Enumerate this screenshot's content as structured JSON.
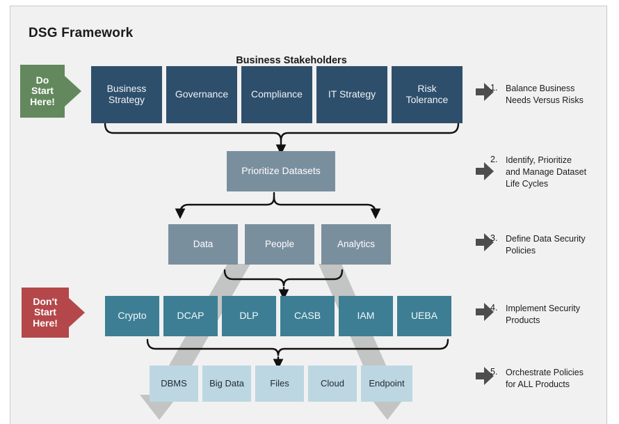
{
  "title": "DSG Framework",
  "section_label": "Business Stakeholders",
  "callouts": {
    "do": {
      "line1": "Do",
      "line2": "Start",
      "line3": "Here!",
      "color": "#63885e"
    },
    "dont": {
      "line1": "Don't",
      "line2": "Start",
      "line3": "Here!",
      "color": "#b4474a"
    }
  },
  "levels": {
    "stakeholders": {
      "name": "Business Stakeholders",
      "color": "#2e4f6b",
      "items": [
        {
          "label": "Business\nStrategy",
          "l1": "Business",
          "l2": "Strategy"
        },
        {
          "label": "Governance",
          "l1": "Governance",
          "l2": ""
        },
        {
          "label": "Compliance",
          "l1": "Compliance",
          "l2": ""
        },
        {
          "label": "IT Strategy",
          "l1": "IT Strategy",
          "l2": ""
        },
        {
          "label": "Risk\nTolerance",
          "l1": "Risk",
          "l2": "Tolerance"
        }
      ]
    },
    "datasets": {
      "color": "#7a8f9e",
      "items": [
        {
          "label": "Prioritize Datasets"
        }
      ]
    },
    "domains": {
      "color": "#7a8f9e",
      "items": [
        {
          "label": "Data"
        },
        {
          "label": "People"
        },
        {
          "label": "Analytics"
        }
      ]
    },
    "products": {
      "color": "#3d7e94",
      "items": [
        {
          "label": "Crypto"
        },
        {
          "label": "DCAP"
        },
        {
          "label": "DLP"
        },
        {
          "label": "CASB"
        },
        {
          "label": "IAM"
        },
        {
          "label": "UEBA"
        }
      ]
    },
    "platforms": {
      "color": "#bcd7e2",
      "items": [
        {
          "label": "DBMS"
        },
        {
          "label": "Big Data"
        },
        {
          "label": "Files"
        },
        {
          "label": "Cloud"
        },
        {
          "label": "Endpoint"
        }
      ]
    }
  },
  "steps": [
    {
      "num": "1.",
      "line1": "Balance Business",
      "line2": "Needs Versus Risks",
      "line3": ""
    },
    {
      "num": "2.",
      "line1": "Identify, Prioritize",
      "line2": "and Manage Dataset",
      "line3": "Life Cycles"
    },
    {
      "num": "3.",
      "line1": "Define Data Security",
      "line2": "Policies",
      "line3": ""
    },
    {
      "num": "4.",
      "line1": "Implement Security",
      "line2": "Products",
      "line3": ""
    },
    {
      "num": "5.",
      "line1": "Orchestrate Policies",
      "line2": "for ALL Products",
      "line3": ""
    }
  ]
}
